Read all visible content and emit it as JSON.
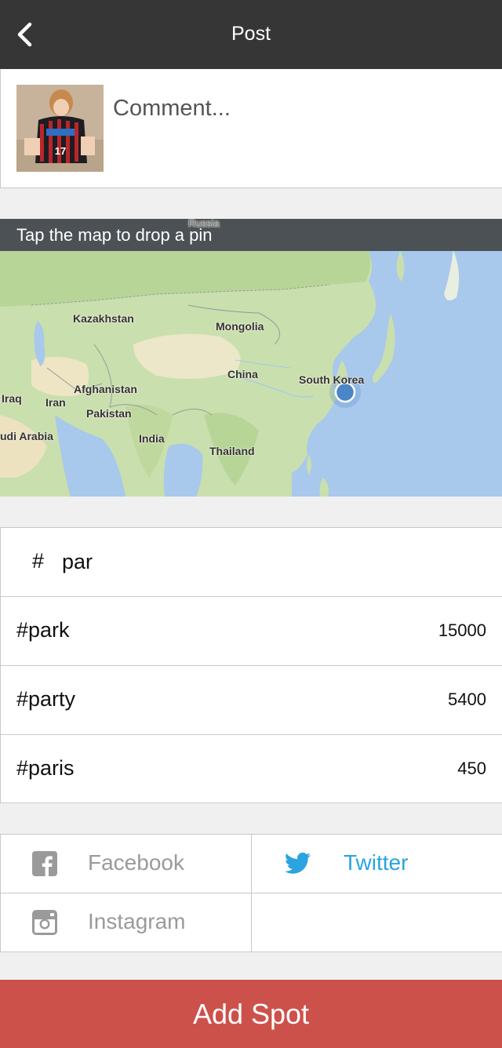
{
  "header": {
    "title": "Post",
    "back_icon": "chevron-left-icon"
  },
  "comment": {
    "placeholder": "Comment...",
    "value": "",
    "avatar_jersey_number": "17"
  },
  "map": {
    "banner": "Tap the map to drop a pin",
    "labels": [
      {
        "name": "Russia"
      },
      {
        "name": "Kazakhstan"
      },
      {
        "name": "Mongolia"
      },
      {
        "name": "China"
      },
      {
        "name": "South Korea"
      },
      {
        "name": "Afghanistan"
      },
      {
        "name": "Iraq"
      },
      {
        "name": "Iran"
      },
      {
        "name": "Pakistan"
      },
      {
        "name": "udi Arabia"
      },
      {
        "name": "India"
      },
      {
        "name": "Thailand"
      }
    ]
  },
  "hashtag": {
    "hash_symbol": "#",
    "value": "par"
  },
  "suggestions": [
    {
      "tag": "#park",
      "count": "15000"
    },
    {
      "tag": "#party",
      "count": "5400"
    },
    {
      "tag": "#paris",
      "count": "450"
    }
  ],
  "share": {
    "facebook": {
      "label": "Facebook",
      "icon": "facebook-icon",
      "selected": false
    },
    "twitter": {
      "label": "Twitter",
      "icon": "twitter-bird-icon",
      "selected": true
    },
    "instagram": {
      "label": "Instagram",
      "icon": "instagram-icon",
      "selected": false
    }
  },
  "submit": {
    "label": "Add Spot"
  },
  "colors": {
    "header_bg": "#353635",
    "accent_red": "#cd514b",
    "twitter_blue": "#2aa3e0",
    "inactive_gray": "#9a9a9a"
  }
}
